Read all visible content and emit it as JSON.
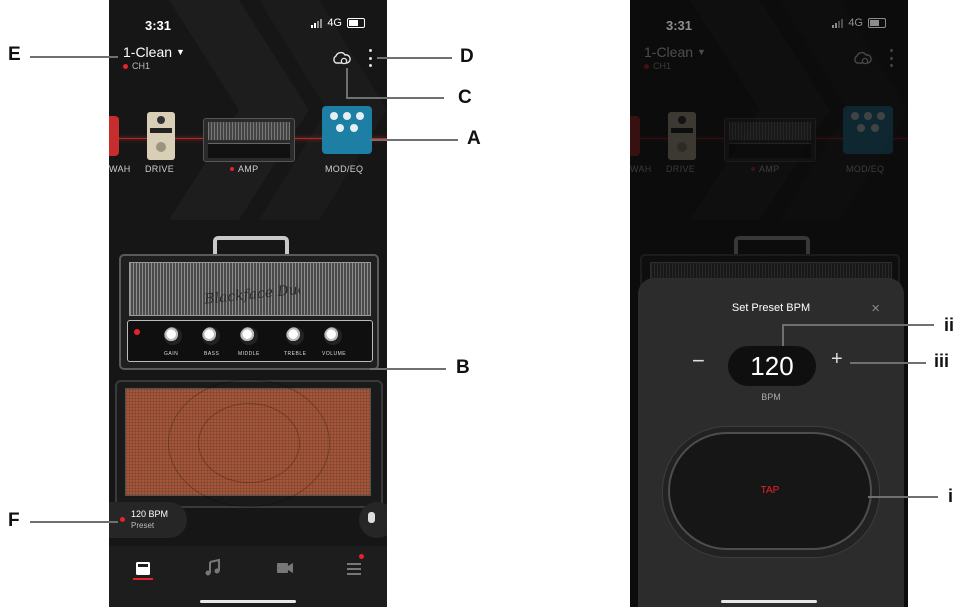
{
  "status_bar": {
    "time": "3:31",
    "network": "4G"
  },
  "header": {
    "preset_name": "1-Clean",
    "channel": "CH1"
  },
  "signal_chain": {
    "labels": [
      "WAH",
      "DRIVE",
      "AMP",
      "MOD/EQ"
    ],
    "active": "AMP"
  },
  "amp": {
    "logo": "Blackface Duo",
    "knobs": [
      "GAIN",
      "BASS",
      "MIDDLE",
      "TREBLE",
      "VOLUME"
    ]
  },
  "bpm_pill": {
    "value": "120 BPM",
    "sublabel": "Preset"
  },
  "tabs": [
    "amp",
    "music",
    "video",
    "menu"
  ],
  "bpm_sheet": {
    "title": "Set Preset BPM",
    "close": "×",
    "minus": "−",
    "plus": "+",
    "value": "120",
    "unit": "BPM",
    "tap": "TAP"
  },
  "callouts": {
    "A": "A",
    "B": "B",
    "C": "C",
    "D": "D",
    "E": "E",
    "F": "F",
    "i": "i",
    "ii": "ii",
    "iii": "iii"
  },
  "colors": {
    "accent": "#e8222a",
    "background": "#161616",
    "sheet": "#2c2c2c"
  }
}
